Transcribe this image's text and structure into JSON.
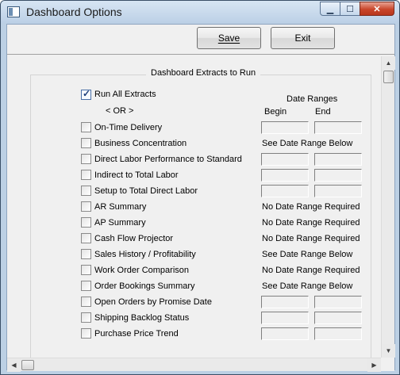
{
  "window": {
    "title": "Dashboard Options"
  },
  "toolbar": {
    "save_label": "Save",
    "exit_label": "Exit"
  },
  "group_title": "Dashboard Extracts to Run",
  "run_all": {
    "label": "Run All Extracts",
    "checked": true
  },
  "or_text": "< OR >",
  "date_ranges": {
    "heading": "Date Ranges",
    "begin": "Begin",
    "end": "End"
  },
  "extracts": [
    {
      "label": "On-Time Delivery",
      "checked": false,
      "range": "fields",
      "note": ""
    },
    {
      "label": "Business Concentration",
      "checked": false,
      "range": "text",
      "note": "See Date Range Below"
    },
    {
      "label": "Direct Labor Performance to Standard",
      "checked": false,
      "range": "fields",
      "note": ""
    },
    {
      "label": "Indirect to Total Labor",
      "checked": false,
      "range": "fields",
      "note": ""
    },
    {
      "label": "Setup to Total Direct Labor",
      "checked": false,
      "range": "fields",
      "note": ""
    },
    {
      "label": "AR Summary",
      "checked": false,
      "range": "text",
      "note": "No Date Range Required"
    },
    {
      "label": "AP Summary",
      "checked": false,
      "range": "text",
      "note": "No Date Range Required"
    },
    {
      "label": "Cash Flow Projector",
      "checked": false,
      "range": "text",
      "note": "No Date Range Required"
    },
    {
      "label": "Sales History / Profitability",
      "checked": false,
      "range": "text",
      "note": "See Date Range Below"
    },
    {
      "label": "Work Order Comparison",
      "checked": false,
      "range": "text",
      "note": "No Date Range Required"
    },
    {
      "label": "Order Bookings Summary",
      "checked": false,
      "range": "text",
      "note": "See Date Range Below"
    },
    {
      "label": "Open Orders by Promise Date",
      "checked": false,
      "range": "fields",
      "note": ""
    },
    {
      "label": "Shipping Backlog Status",
      "checked": false,
      "range": "fields",
      "note": ""
    },
    {
      "label": "Purchase Price Trend",
      "checked": false,
      "range": "fields",
      "note": ""
    }
  ]
}
